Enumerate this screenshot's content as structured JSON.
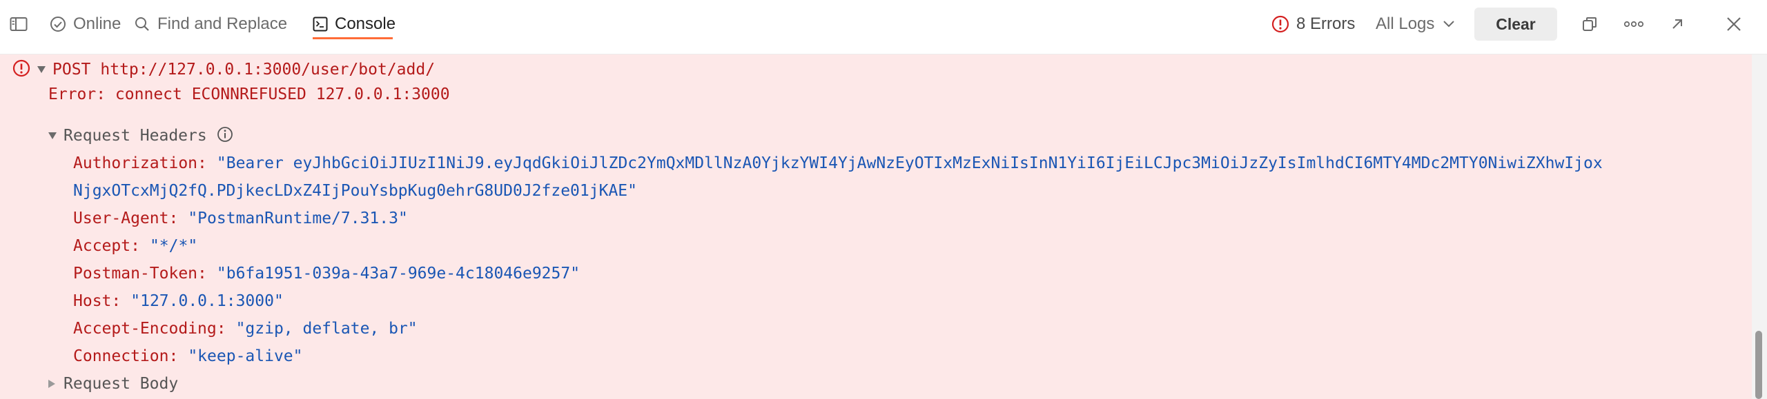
{
  "toolbar": {
    "online_label": "Online",
    "find_replace_label": "Find and Replace",
    "console_label": "Console",
    "errors_label": "8 Errors",
    "logs_filter_label": "All Logs",
    "clear_label": "Clear"
  },
  "log": {
    "method": "POST",
    "url": "http://127.0.0.1:3000/user/bot/add/",
    "error_message": "Error: connect ECONNREFUSED 127.0.0.1:3000",
    "request_headers_label": "Request Headers",
    "headers": [
      {
        "key": "Authorization:",
        "value": "\"Bearer eyJhbGciOiJIUzI1NiJ9.eyJqdGkiOiJlZDc2YmQxMDllNzA0YjkzYWI4YjAwNzEyOTIxMzExNiIsInN1YiI6IjEiLCJpc3MiOiJzZyIsImlhdCI6MTY4MDc2MTY0NiwiZXhwIjox",
        "value_cont": "NjgxOTcxMjQ2fQ.PDjkecLDxZ4IjPouYsbpKug0ehrG8UD0J2fze01jKAE\""
      },
      {
        "key": "User-Agent:",
        "value": "\"PostmanRuntime/7.31.3\""
      },
      {
        "key": "Accept:",
        "value": "\"*/*\""
      },
      {
        "key": "Postman-Token:",
        "value": "\"b6fa1951-039a-43a7-969e-4c18046e9257\""
      },
      {
        "key": "Host:",
        "value": "\"127.0.0.1:3000\""
      },
      {
        "key": "Accept-Encoding:",
        "value": "\"gzip, deflate, br\""
      },
      {
        "key": "Connection:",
        "value": "\"keep-alive\""
      }
    ],
    "request_body_label": "Request Body"
  },
  "colors": {
    "accent": "#ff6c37",
    "error_bg": "#fde8e8",
    "error_text": "#b41a1a",
    "value_text": "#1a56b4"
  }
}
